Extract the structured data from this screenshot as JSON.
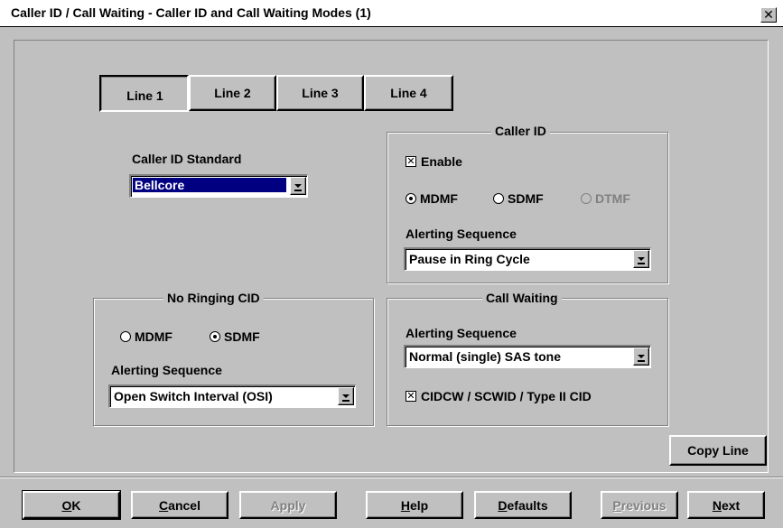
{
  "window": {
    "title": "Caller ID / Call Waiting - Caller ID and Call Waiting Modes (1)",
    "close_glyph": "✕"
  },
  "line_tabs": [
    {
      "label": "Line 1",
      "selected": true
    },
    {
      "label": "Line 2",
      "selected": false
    },
    {
      "label": "Line 3",
      "selected": false
    },
    {
      "label": "Line 4",
      "selected": false
    }
  ],
  "caller_id_standard": {
    "label": "Caller ID Standard",
    "value": "Bellcore"
  },
  "caller_id": {
    "title": "Caller ID",
    "enable": {
      "label": "Enable",
      "checked": true
    },
    "modes": [
      {
        "label": "MDMF",
        "selected": true,
        "enabled": true
      },
      {
        "label": "SDMF",
        "selected": false,
        "enabled": true
      },
      {
        "label": "DTMF",
        "selected": false,
        "enabled": false
      }
    ],
    "alerting_label": "Alerting Sequence",
    "alerting_value": "Pause in Ring Cycle"
  },
  "no_ringing_cid": {
    "title": "No Ringing CID",
    "modes": [
      {
        "label": "MDMF",
        "selected": false
      },
      {
        "label": "SDMF",
        "selected": true
      }
    ],
    "alerting_label": "Alerting Sequence",
    "alerting_value": "Open Switch Interval (OSI)"
  },
  "call_waiting": {
    "title": "Call Waiting",
    "alerting_label": "Alerting Sequence",
    "alerting_value": "Normal (single) SAS tone",
    "cidcw": {
      "label": "CIDCW / SCWID / Type II CID",
      "checked": true
    }
  },
  "copy_line_label": "Copy Line",
  "footer": {
    "ok": {
      "mnemonic": "O",
      "rest": "K"
    },
    "cancel": {
      "mnemonic": "C",
      "rest": "ancel"
    },
    "apply": {
      "mnemonic": "",
      "rest": "Apply",
      "disabled": true
    },
    "help": {
      "mnemonic": "H",
      "rest": "elp"
    },
    "defaults": {
      "mnemonic": "D",
      "rest": "efaults"
    },
    "previous": {
      "mnemonic": "P",
      "rest": "revious",
      "disabled": true
    },
    "next": {
      "mnemonic": "N",
      "rest": "ext"
    }
  },
  "check_glyph": "✕"
}
